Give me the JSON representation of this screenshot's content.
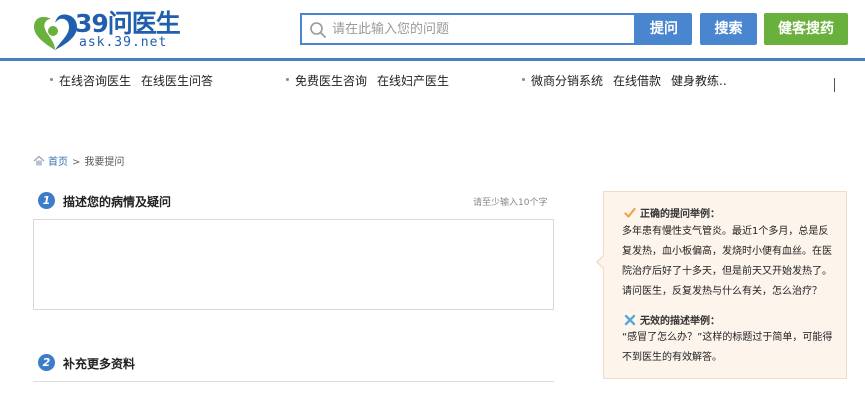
{
  "header": {
    "logo_title": "39问医生",
    "logo_subtitle": "ask.39.net",
    "search_placeholder": "请在此输入您的问题",
    "ask_button": "提问",
    "search_button": "搜索",
    "medicine_button": "健客搜药",
    "colors": {
      "brand_blue": "#4a86cf",
      "green": "#6ab03d"
    }
  },
  "nav": {
    "groups": [
      {
        "links": [
          "在线咨询医生",
          "在线医生问答"
        ]
      },
      {
        "links": [
          "免费医生咨询",
          "在线妇产医生"
        ]
      },
      {
        "links": [
          "微商分销系统",
          "在线借款",
          "健身教练.."
        ]
      }
    ]
  },
  "breadcrumb": {
    "home": "首页",
    "separator": ">",
    "current": "我要提问"
  },
  "form": {
    "step1": {
      "number": "1",
      "title": "描述您的病情及疑问",
      "hint": "请至少输入10个字"
    },
    "step2": {
      "number": "2",
      "title": "补充更多资料"
    }
  },
  "tips": {
    "good_heading": "正确的提问举例：",
    "good_text": "多年患有慢性支气管炎。最近1个多月，总是反复发热，血小板偏高，发烧时小便有血丝。在医院治疗后好了十多天，但是前天又开始发热了。请问医生，反复发热与什么有关，怎么治疗？",
    "bad_heading": "无效的描述举例：",
    "bad_text": "“感冒了怎么办？”这样的标题过于简单，可能得不到医生的有效解答。",
    "colors": {
      "check": "#f0a050",
      "cross": "#5aa8d8"
    }
  }
}
